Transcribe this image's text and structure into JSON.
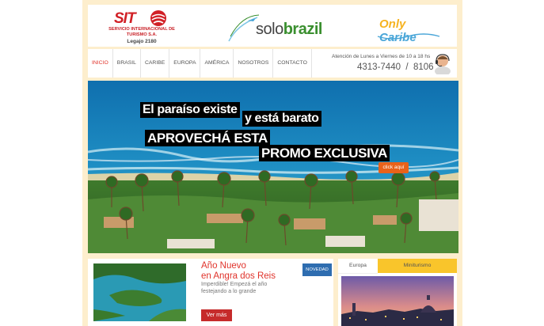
{
  "header": {
    "sit": {
      "word": "SIT",
      "name": "SERVICIO INTERNACIONAL DE TURISMO S.A.",
      "legajo": "Legajo 2180"
    },
    "solobrazil": {
      "solo": "solo",
      "brazil": "brazil"
    },
    "onlycaribe": {
      "only": "Only",
      "caribe": "Caribe"
    }
  },
  "nav": {
    "items": [
      "INICIO",
      "BRASIL",
      "CARIBE",
      "EUROPA",
      "AMÉRICA",
      "NOSOTROS",
      "CONTACTO"
    ],
    "hours": "Atención de Lunes a Viernes de 10 a 18 hs",
    "phone": "4313-7440  /  8106"
  },
  "hero": {
    "line1": "El paraíso existe",
    "line2": "y está barato",
    "line3": "APROVECHÁ ESTA",
    "line4": "PROMO EXCLUSIVA",
    "button": "click aquí"
  },
  "card": {
    "title_line1": "Año Nuevo",
    "title_line2": "en Angra dos Reis",
    "desc": "Imperdible! Empezá el año festejando a lo grande",
    "button": "Ver más",
    "badge": "NOVEDAD"
  },
  "sidebox": {
    "tabs": [
      "Europa",
      "Miniturismo"
    ]
  },
  "colors": {
    "accent": "#e0332b",
    "frame": "#fdeecd",
    "tab": "#f9c52b",
    "badge": "#2e6db0"
  }
}
